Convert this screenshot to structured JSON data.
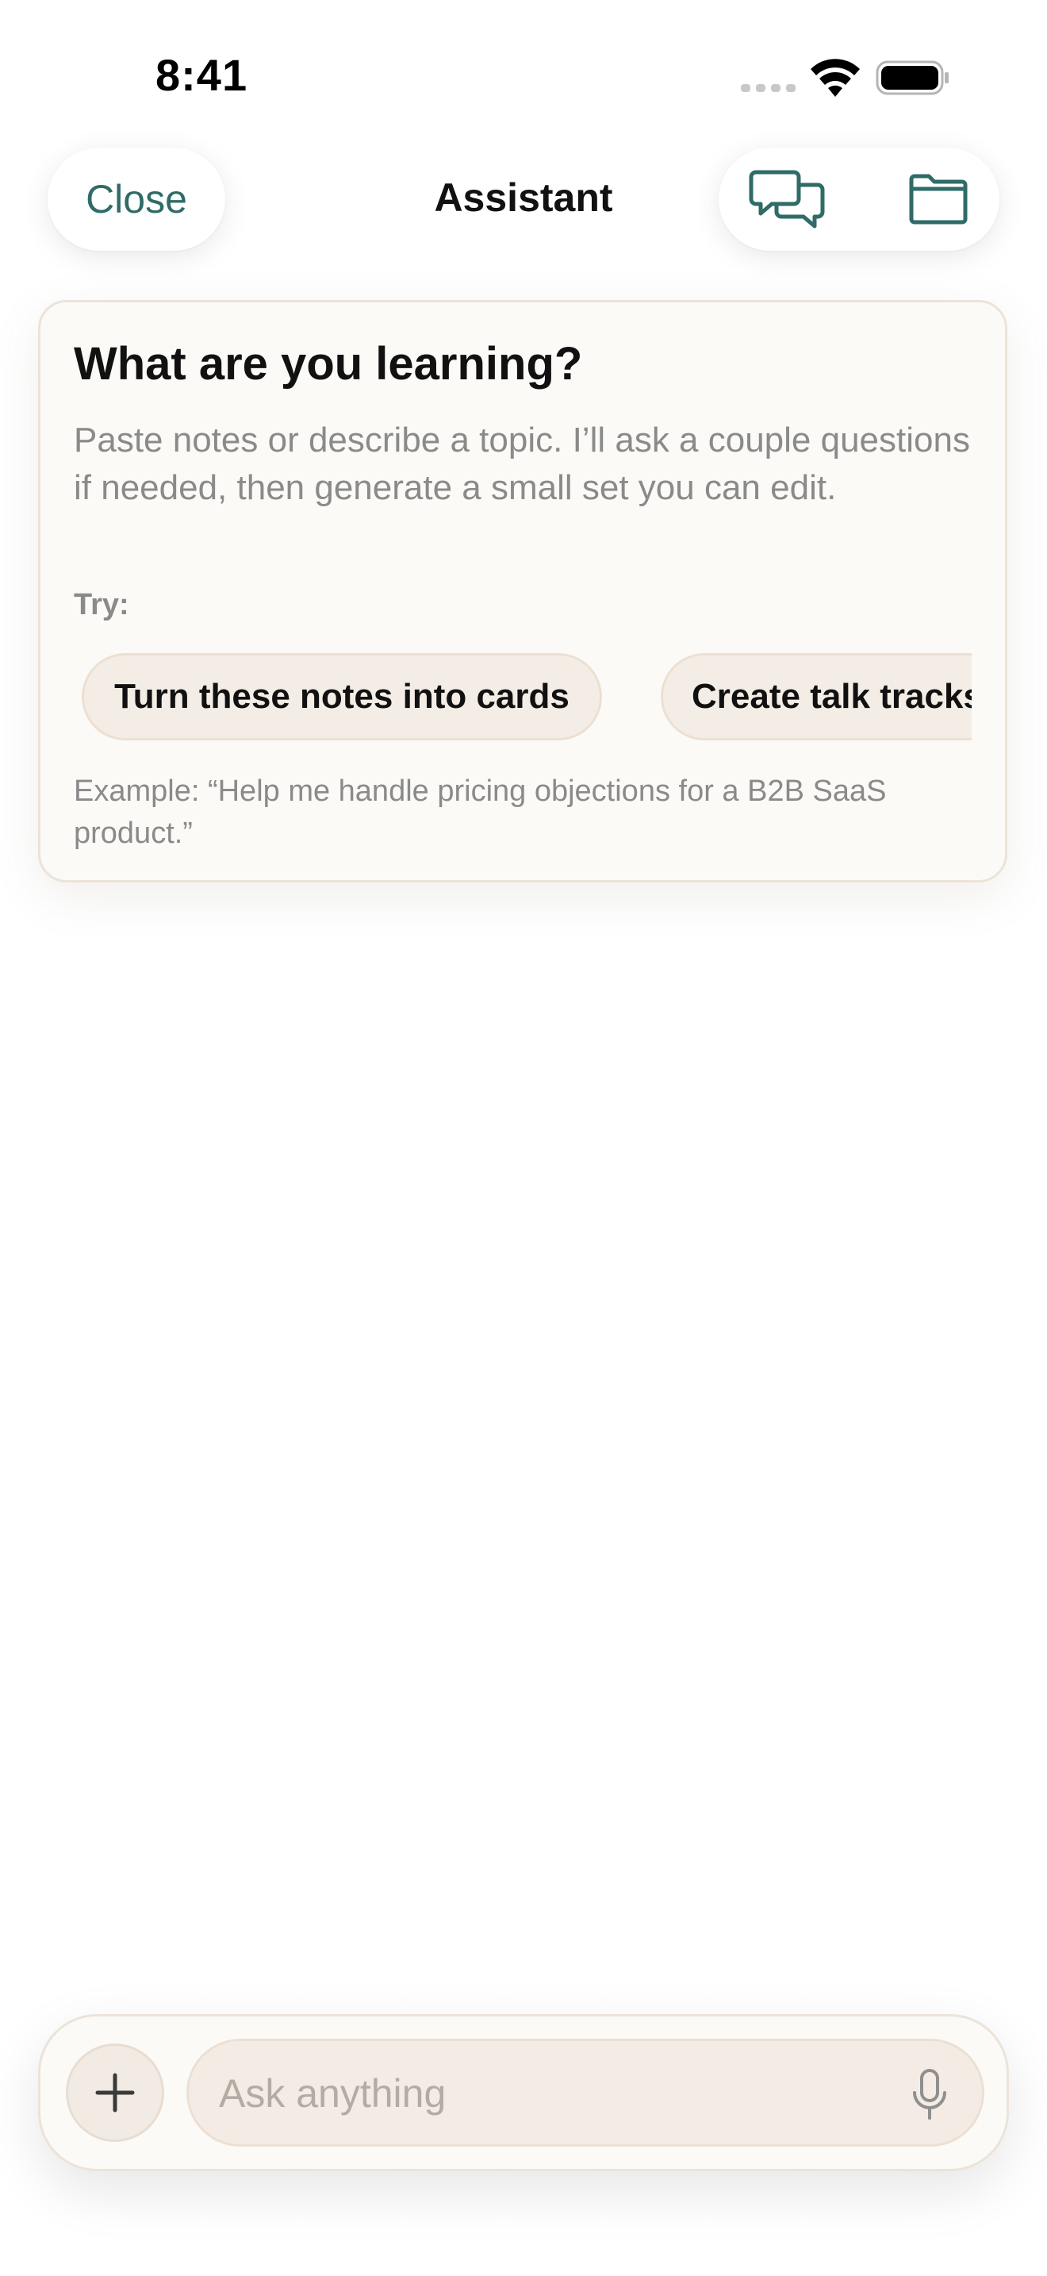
{
  "status_bar": {
    "time": "8:41"
  },
  "nav": {
    "close_label": "Close",
    "title": "Assistant",
    "icons": [
      "chat-bubbles-icon",
      "folder-icon"
    ],
    "accent_color": "#2f6b67"
  },
  "onboarding": {
    "title": "What are you learning?",
    "description": "Paste notes or describe a topic. I’ll ask a couple questions if needed, then generate a small set you can edit.",
    "try_label": "Try:",
    "suggestions": [
      "Turn these notes into cards",
      "Create talk tracks for"
    ],
    "example": "Example: “Help me handle pricing objections for a B2B SaaS product.”"
  },
  "composer": {
    "placeholder": "Ask anything",
    "icons": [
      "plus-icon",
      "microphone-icon"
    ]
  },
  "colors": {
    "card_background": "#fcfaf7",
    "chip_background": "#f4ede5",
    "muted_text": "#8a8a8a"
  }
}
